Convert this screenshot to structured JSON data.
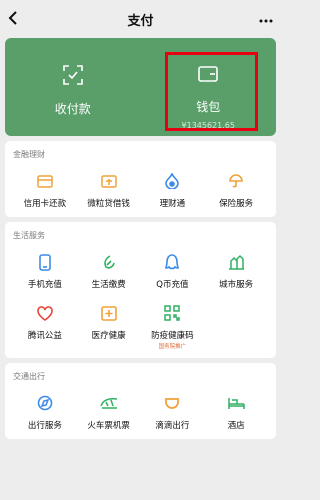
{
  "header": {
    "title": "支付",
    "back_icon": "chevron-left-icon",
    "more_icon": "ellipsis-icon"
  },
  "top_card": {
    "receive": {
      "label": "收付款",
      "icon": "scan-check-icon"
    },
    "wallet": {
      "label": "钱包",
      "balance": "¥1345621.65",
      "icon": "wallet-icon"
    }
  },
  "finance": {
    "title": "金融理财",
    "items": [
      {
        "label": "信用卡还款",
        "icon": "credit-card-icon"
      },
      {
        "label": "微粒贷借钱",
        "icon": "loan-box-icon"
      },
      {
        "label": "理财通",
        "icon": "water-drop-icon"
      },
      {
        "label": "保险服务",
        "icon": "umbrella-icon"
      }
    ]
  },
  "life": {
    "title": "生活服务",
    "items": [
      {
        "label": "手机充值",
        "icon": "phone-icon"
      },
      {
        "label": "生活缴费",
        "icon": "leaf-icon"
      },
      {
        "label": "Q币充值",
        "icon": "penguin-icon"
      },
      {
        "label": "城市服务",
        "icon": "building-icon"
      },
      {
        "label": "腾讯公益",
        "icon": "heart-icon"
      },
      {
        "label": "医疗健康",
        "icon": "medical-cross-icon"
      },
      {
        "label": "防疫健康码",
        "icon": "qr-code-icon",
        "tag": "国务院推广"
      }
    ]
  },
  "transport": {
    "title": "交通出行",
    "items": [
      {
        "label": "出行服务",
        "icon": "compass-icon"
      },
      {
        "label": "火车票机票",
        "icon": "train-icon"
      },
      {
        "label": "滴滴出行",
        "icon": "didi-icon"
      },
      {
        "label": "酒店",
        "icon": "bed-icon"
      }
    ]
  },
  "colors": {
    "green": "#5a9f6a",
    "accent_green": "#2fb160",
    "accent_blue": "#3d8be8",
    "accent_orange": "#f0a13a",
    "accent_red": "#e7473a",
    "highlight": "#e60012"
  }
}
